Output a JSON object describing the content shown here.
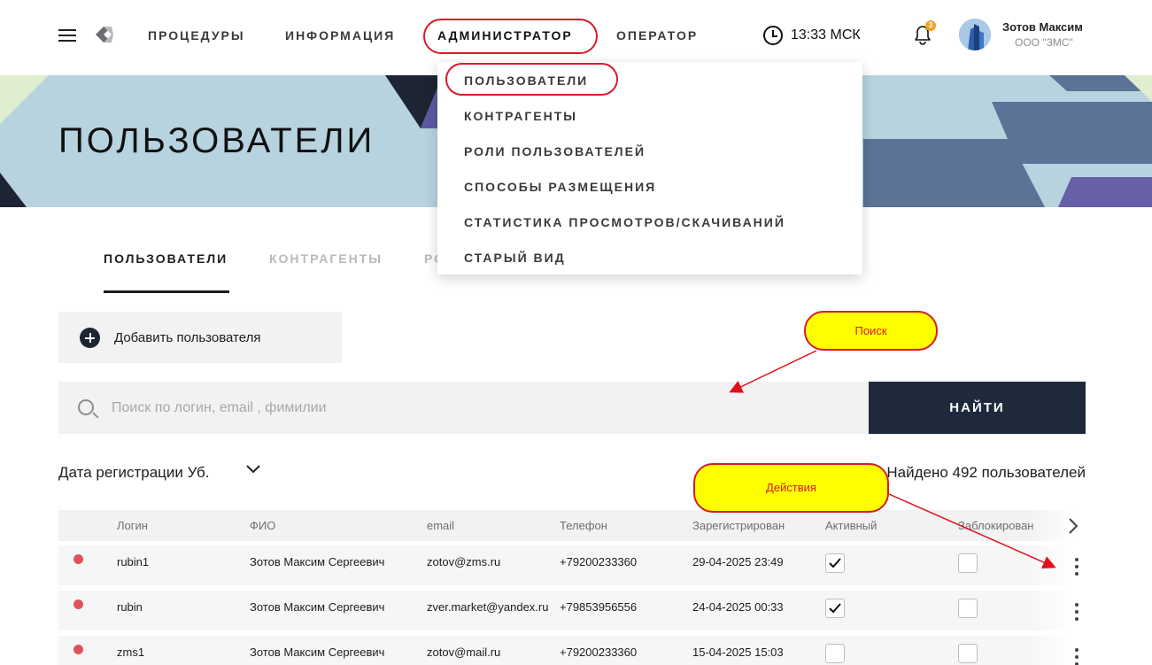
{
  "header": {
    "nav": [
      {
        "label": "ПРОЦЕДУРЫ"
      },
      {
        "label": "ИНФОРМАЦИЯ"
      },
      {
        "label": "АДМИНИСТРАТОР"
      },
      {
        "label": "ОПЕРАТОР"
      }
    ],
    "active_nav": "АДМИНИСТРАТОР",
    "time": "13:33 МСК",
    "notifications_count": "3",
    "user": {
      "name": "Зотов Максим",
      "org": "ООО \"ЗМС\""
    }
  },
  "icons": [
    "menu-icon",
    "logo-icon",
    "clock-icon",
    "bell-icon",
    "avatar-image",
    "search-icon",
    "plus-circle-icon",
    "chevron-down-icon",
    "chevron-right-icon",
    "kebab-menu-icon",
    "check-icon"
  ],
  "banner": {
    "title": "ПОЛЬЗОВАТЕЛИ"
  },
  "admin_menu": {
    "items": [
      {
        "label": "ПОЛЬЗОВАТЕЛИ"
      },
      {
        "label": "КОНТРАГЕНТЫ"
      },
      {
        "label": "РОЛИ ПОЛЬЗОВАТЕЛЕЙ"
      },
      {
        "label": "СПОСОБЫ РАЗМЕЩЕНИЯ"
      },
      {
        "label": "СТАТИСТИКА ПРОСМОТРОВ/СКАЧИВАНИЙ"
      },
      {
        "label": "СТАРЫЙ ВИД"
      }
    ]
  },
  "tabs": [
    {
      "label": "ПОЛЬЗОВАТЕЛИ",
      "active": true
    },
    {
      "label": "КОНТРАГЕНТЫ",
      "active": false
    },
    {
      "label": "РО",
      "active": false
    }
  ],
  "actions": {
    "add_user": "Добавить пользователя"
  },
  "search": {
    "placeholder": "Поиск по логин, email , фимилии",
    "button": "НАЙТИ"
  },
  "sort": {
    "label": "Дата регистрации Уб."
  },
  "found": "Найдено 492 пользователей",
  "table": {
    "columns": [
      "Логин",
      "ФИО",
      "email",
      "Телефон",
      "Зарегистрирован",
      "Активный",
      "Заблокирован"
    ],
    "rows": [
      {
        "login": "rubin1",
        "fio": "Зотов Максим Сергеевич",
        "email": "zotov@zms.ru",
        "phone": "+79200233360",
        "registered": "29-04-2025 23:49",
        "active": true,
        "blocked": false
      },
      {
        "login": "rubin",
        "fio": "Зотов Максим Сергеевич",
        "email": "zver.market@yandex.ru",
        "phone": "+79853956556",
        "registered": "24-04-2025 00:33",
        "active": true,
        "blocked": false
      },
      {
        "login": "zms1",
        "fio": "Зотов Максим Сергеевич",
        "email": "zotov@mail.ru",
        "phone": "+79200233360",
        "registered": "15-04-2025 15:03",
        "active": false,
        "blocked": false
      }
    ]
  },
  "annotations": {
    "search": "Поиск",
    "actions": "Действия"
  },
  "colors": {
    "accent_dark": "#1e2a3c",
    "annotation_red": "#d91a2a",
    "annotation_yellow": "#ffff00",
    "status_red": "#e0525a",
    "banner_bg": "#b7d3df"
  }
}
